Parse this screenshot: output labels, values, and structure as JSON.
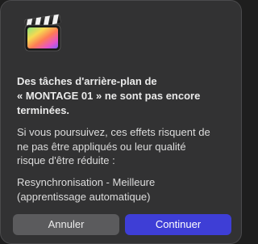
{
  "dialog": {
    "app_icon": "final-cut-pro-icon",
    "heading_lines": [
      "Des tâches d'arrière-plan de",
      "« MONTAGE 01 » ne sont pas encore",
      "terminées."
    ],
    "body_lines": [
      "Si vous poursuivez, ces effets risquent de",
      "ne pas être appliqués ou leur qualité",
      "risque d'être réduite :"
    ],
    "effects_lines": [
      "Resynchronisation - Meilleure",
      "(apprentissage automatique)"
    ]
  },
  "buttons": {
    "cancel_label": "Annuler",
    "continue_label": "Continuer"
  },
  "colors": {
    "dialog_background": "#323233",
    "primary_button": "#3e3ed6",
    "secondary_button": "#5b5b5d"
  }
}
